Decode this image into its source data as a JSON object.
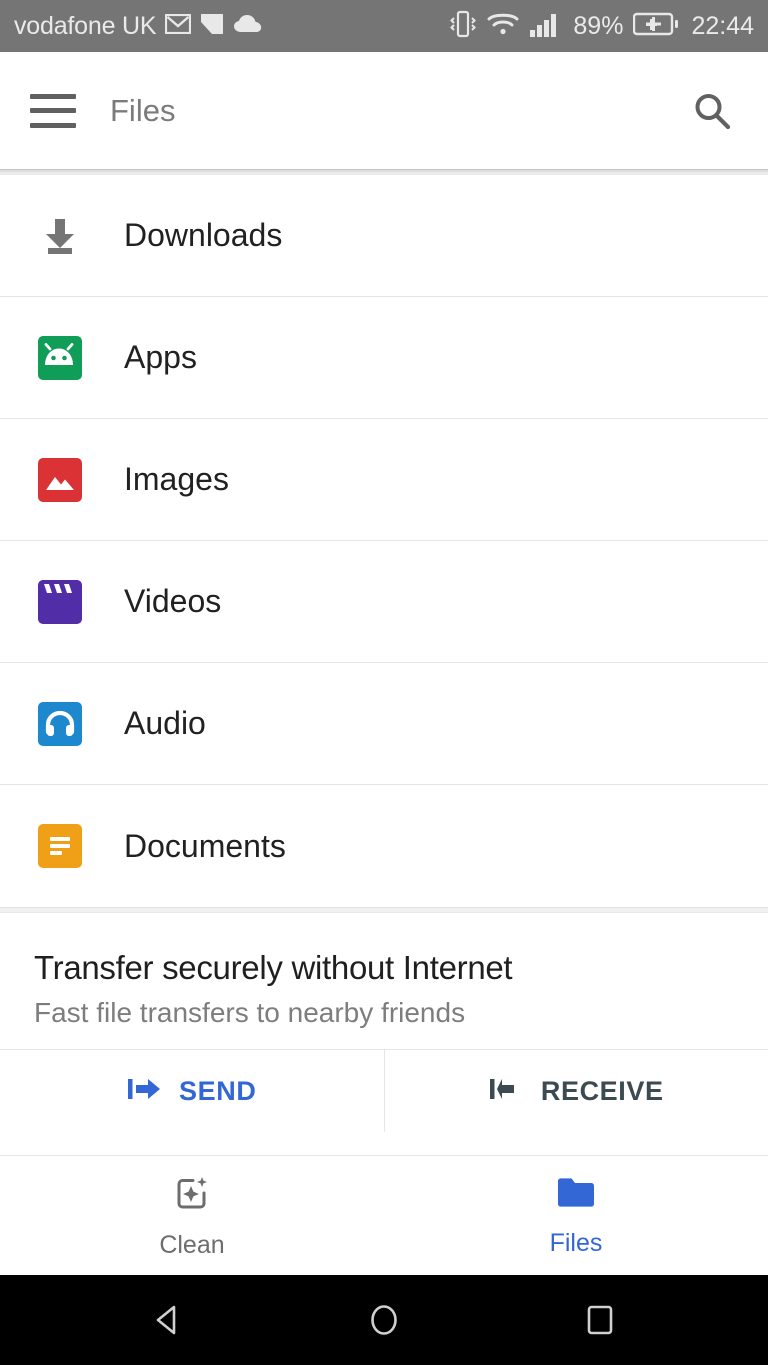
{
  "status_bar": {
    "carrier": "vodafone UK",
    "battery_percent": "89%",
    "time": "22:44",
    "icons": [
      "gmail-icon",
      "notification-icon",
      "cloud-icon",
      "vibrate-icon",
      "wifi-icon",
      "signal-icon",
      "battery-charging-icon"
    ],
    "background_color": "#757575",
    "text_color": "#eaeaea"
  },
  "app_bar": {
    "title": "Files",
    "menu_icon": "hamburger-icon",
    "search_icon": "search-icon"
  },
  "file_categories": [
    {
      "label": "Downloads",
      "icon": "download-icon",
      "color": "#757575"
    },
    {
      "label": "Apps",
      "icon": "android-icon",
      "color": "#0f9d58"
    },
    {
      "label": "Images",
      "icon": "image-icon",
      "color": "#db3236"
    },
    {
      "label": "Videos",
      "icon": "clapperboard-icon",
      "color": "#512da8"
    },
    {
      "label": "Audio",
      "icon": "headphones-icon",
      "color": "#1e88cf"
    },
    {
      "label": "Documents",
      "icon": "document-icon",
      "color": "#f0a017"
    }
  ],
  "promo": {
    "title": "Transfer securely without Internet",
    "subtitle": "Fast file transfers to nearby friends",
    "send_label": "SEND",
    "send_icon": "send-arrow-icon",
    "send_color": "#3367d6",
    "receive_label": "RECEIVE",
    "receive_icon": "receive-arrow-icon",
    "receive_color": "#3c4a52"
  },
  "bottom_nav": {
    "items": [
      {
        "label": "Clean",
        "icon": "clean-sparkle-icon",
        "active": false,
        "color": "#6d6d6d"
      },
      {
        "label": "Files",
        "icon": "folder-icon",
        "active": true,
        "color": "#3367d6"
      }
    ]
  },
  "android_nav": {
    "back_icon": "back-triangle-icon",
    "home_icon": "home-circle-icon",
    "recents_icon": "recents-square-icon",
    "background_color": "#000000"
  }
}
